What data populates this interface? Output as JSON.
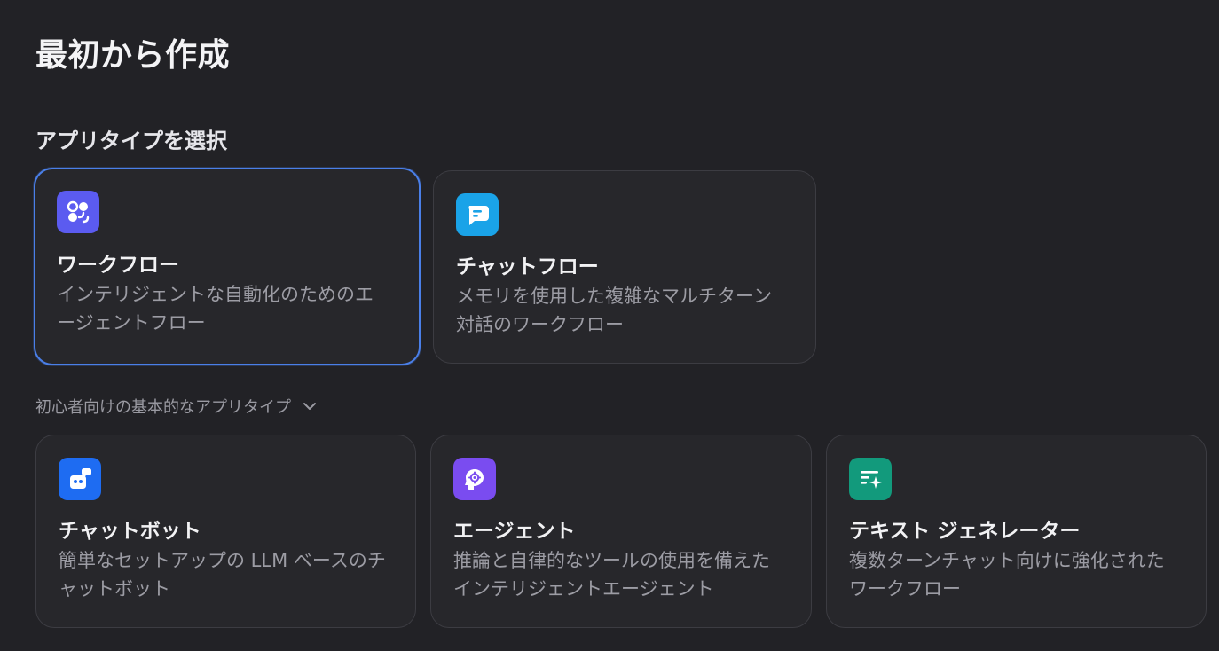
{
  "header": {
    "title": "最初から作成"
  },
  "app_type_section": {
    "title": "アプリタイプを選択"
  },
  "primary_cards": [
    {
      "id": "workflow",
      "title": "ワークフロー",
      "description": "インテリジェントな自動化のためのエージェントフロー",
      "icon": "workflow-icon",
      "icon_color": "#5b5bf0",
      "selected": true
    },
    {
      "id": "chatflow",
      "title": "チャットフロー",
      "description": "メモリを使用した複雑なマルチターン対話のワークフロー",
      "icon": "chat-bubble-icon",
      "icon_color": "#1aa3e8",
      "selected": false
    }
  ],
  "basic_section": {
    "label": "初心者向けの基本的なアプリタイプ",
    "icon": "chevron-down-icon"
  },
  "basic_cards": [
    {
      "id": "chatbot",
      "title": "チャットボット",
      "description": "簡単なセットアップの LLM ベースのチャットボット",
      "icon": "bot-icon",
      "icon_color": "#1e6cf2"
    },
    {
      "id": "agent",
      "title": "エージェント",
      "description": "推論と自律的なツールの使用を備えたインテリジェントエージェント",
      "icon": "agent-head-icon",
      "icon_color": "#7a4cf0"
    },
    {
      "id": "text-generator",
      "title": "テキスト ジェネレーター",
      "description": "複数ターンチャット向けに強化されたワークフロー",
      "icon": "text-sparkle-icon",
      "icon_color": "#129a7c"
    }
  ],
  "colors": {
    "background": "#222226",
    "card": "#27272b",
    "card_border": "#3c3c42",
    "selected_border": "#4a7fe8"
  }
}
